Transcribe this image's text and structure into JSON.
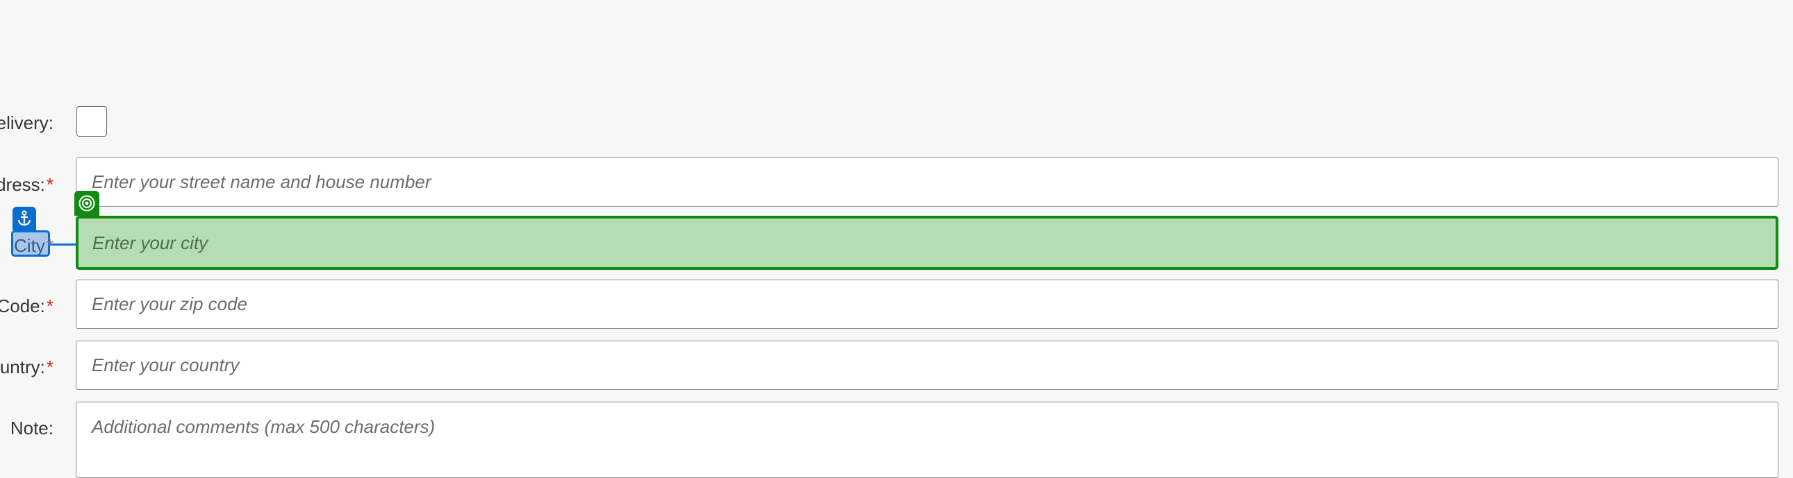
{
  "form": {
    "delivery": {
      "label": "elivery:",
      "checked": false
    },
    "address": {
      "label": "ldress:",
      "required_mark": "*",
      "placeholder": "Enter your street name and house number"
    },
    "city": {
      "label": "City",
      "required_mark": "*",
      "placeholder": "Enter your city"
    },
    "zip": {
      "label": "Code:",
      "required_mark": "*",
      "placeholder": "Enter your zip code"
    },
    "country": {
      "label": "ountry:",
      "required_mark": "*",
      "placeholder": "Enter your country"
    },
    "note": {
      "label": "Note:",
      "placeholder": "Additional comments (max 500 characters)"
    }
  },
  "overlay": {
    "target_icon": "target-icon",
    "anchor_icon": "anchor-icon",
    "target_color": "#138a13",
    "anchor_color": "#0a6ed1"
  }
}
